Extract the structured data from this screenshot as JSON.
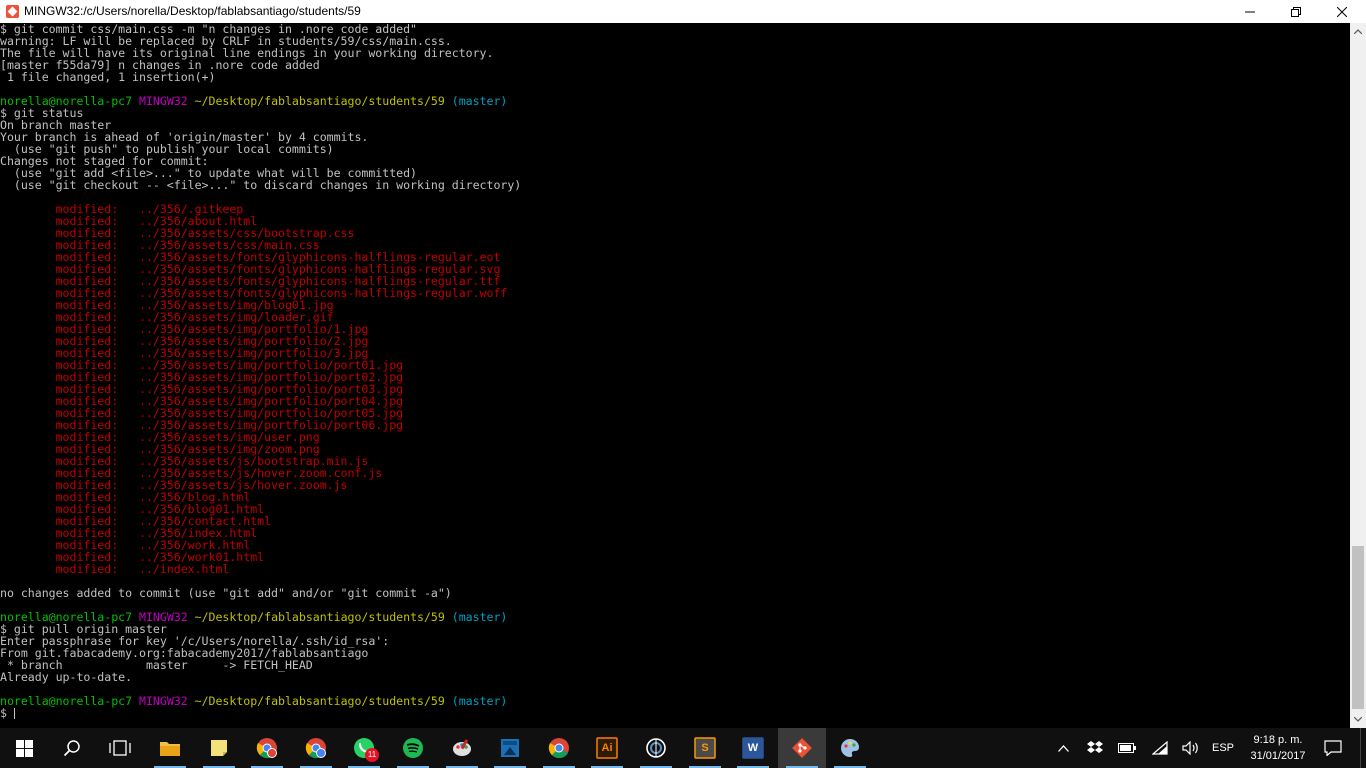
{
  "window": {
    "title": "MINGW32:/c/Users/norella/Desktop/fablabsantiago/students/59"
  },
  "terminal": {
    "lines": [
      [
        {
          "t": "$ git commit css/main.css -m \"n changes in .nore code added\"",
          "c": "default"
        }
      ],
      [
        {
          "t": "warning: LF will be replaced by CRLF in students/59/css/main.css.",
          "c": "default"
        }
      ],
      [
        {
          "t": "The file will have its original line endings in your working directory.",
          "c": "default"
        }
      ],
      [
        {
          "t": "[master f55da79] n changes in .nore code added",
          "c": "default"
        }
      ],
      [
        {
          "t": " 1 file changed, 1 insertion(+)",
          "c": "default"
        }
      ],
      [],
      [
        {
          "t": "norella@norella-pc7",
          "c": "green"
        },
        {
          "t": " ",
          "c": "default"
        },
        {
          "t": "MINGW32",
          "c": "magenta"
        },
        {
          "t": " ",
          "c": "default"
        },
        {
          "t": "~/Desktop/fablabsantiago/students/59",
          "c": "yellow"
        },
        {
          "t": " ",
          "c": "default"
        },
        {
          "t": "(master)",
          "c": "cyan"
        }
      ],
      [
        {
          "t": "$ git status",
          "c": "default"
        }
      ],
      [
        {
          "t": "On branch master",
          "c": "default"
        }
      ],
      [
        {
          "t": "Your branch is ahead of 'origin/master' by 4 commits.",
          "c": "default"
        }
      ],
      [
        {
          "t": "  (use \"git push\" to publish your local commits)",
          "c": "default"
        }
      ],
      [
        {
          "t": "Changes not staged for commit:",
          "c": "default"
        }
      ],
      [
        {
          "t": "  (use \"git add <file>...\" to update what will be committed)",
          "c": "default"
        }
      ],
      [
        {
          "t": "  (use \"git checkout -- <file>...\" to discard changes in working directory)",
          "c": "default"
        }
      ],
      [],
      [
        {
          "t": "        modified:   ../356/.gitkeep",
          "c": "red"
        }
      ],
      [
        {
          "t": "        modified:   ../356/about.html",
          "c": "red"
        }
      ],
      [
        {
          "t": "        modified:   ../356/assets/css/bootstrap.css",
          "c": "red"
        }
      ],
      [
        {
          "t": "        modified:   ../356/assets/css/main.css",
          "c": "red"
        }
      ],
      [
        {
          "t": "        modified:   ../356/assets/fonts/glyphicons-halflings-regular.eot",
          "c": "red"
        }
      ],
      [
        {
          "t": "        modified:   ../356/assets/fonts/glyphicons-halflings-regular.svg",
          "c": "red"
        }
      ],
      [
        {
          "t": "        modified:   ../356/assets/fonts/glyphicons-halflings-regular.ttf",
          "c": "red"
        }
      ],
      [
        {
          "t": "        modified:   ../356/assets/fonts/glyphicons-halflings-regular.woff",
          "c": "red"
        }
      ],
      [
        {
          "t": "        modified:   ../356/assets/img/blog01.jpg",
          "c": "red"
        }
      ],
      [
        {
          "t": "        modified:   ../356/assets/img/loader.gif",
          "c": "red"
        }
      ],
      [
        {
          "t": "        modified:   ../356/assets/img/portfolio/1.jpg",
          "c": "red"
        }
      ],
      [
        {
          "t": "        modified:   ../356/assets/img/portfolio/2.jpg",
          "c": "red"
        }
      ],
      [
        {
          "t": "        modified:   ../356/assets/img/portfolio/3.jpg",
          "c": "red"
        }
      ],
      [
        {
          "t": "        modified:   ../356/assets/img/portfolio/port01.jpg",
          "c": "red"
        }
      ],
      [
        {
          "t": "        modified:   ../356/assets/img/portfolio/port02.jpg",
          "c": "red"
        }
      ],
      [
        {
          "t": "        modified:   ../356/assets/img/portfolio/port03.jpg",
          "c": "red"
        }
      ],
      [
        {
          "t": "        modified:   ../356/assets/img/portfolio/port04.jpg",
          "c": "red"
        }
      ],
      [
        {
          "t": "        modified:   ../356/assets/img/portfolio/port05.jpg",
          "c": "red"
        }
      ],
      [
        {
          "t": "        modified:   ../356/assets/img/portfolio/port06.jpg",
          "c": "red"
        }
      ],
      [
        {
          "t": "        modified:   ../356/assets/img/user.png",
          "c": "red"
        }
      ],
      [
        {
          "t": "        modified:   ../356/assets/img/zoom.png",
          "c": "red"
        }
      ],
      [
        {
          "t": "        modified:   ../356/assets/js/bootstrap.min.js",
          "c": "red"
        }
      ],
      [
        {
          "t": "        modified:   ../356/assets/js/hover.zoom.conf.js",
          "c": "red"
        }
      ],
      [
        {
          "t": "        modified:   ../356/assets/js/hover.zoom.js",
          "c": "red"
        }
      ],
      [
        {
          "t": "        modified:   ../356/blog.html",
          "c": "red"
        }
      ],
      [
        {
          "t": "        modified:   ../356/blog01.html",
          "c": "red"
        }
      ],
      [
        {
          "t": "        modified:   ../356/contact.html",
          "c": "red"
        }
      ],
      [
        {
          "t": "        modified:   ../356/index.html",
          "c": "red"
        }
      ],
      [
        {
          "t": "        modified:   ../356/work.html",
          "c": "red"
        }
      ],
      [
        {
          "t": "        modified:   ../356/work01.html",
          "c": "red"
        }
      ],
      [
        {
          "t": "        modified:   ../index.html",
          "c": "red"
        }
      ],
      [],
      [
        {
          "t": "no changes added to commit (use \"git add\" and/or \"git commit -a\")",
          "c": "default"
        }
      ],
      [],
      [
        {
          "t": "norella@norella-pc7",
          "c": "green"
        },
        {
          "t": " ",
          "c": "default"
        },
        {
          "t": "MINGW32",
          "c": "magenta"
        },
        {
          "t": " ",
          "c": "default"
        },
        {
          "t": "~/Desktop/fablabsantiago/students/59",
          "c": "yellow"
        },
        {
          "t": " ",
          "c": "default"
        },
        {
          "t": "(master)",
          "c": "cyan"
        }
      ],
      [
        {
          "t": "$ git pull origin master",
          "c": "default"
        }
      ],
      [
        {
          "t": "Enter passphrase for key '/c/Users/norella/.ssh/id_rsa':",
          "c": "default"
        }
      ],
      [
        {
          "t": "From git.fabacademy.org:fabacademy2017/fablabsantiago",
          "c": "default"
        }
      ],
      [
        {
          "t": " * branch            master     -> FETCH_HEAD",
          "c": "default"
        }
      ],
      [
        {
          "t": "Already up-to-date.",
          "c": "default"
        }
      ],
      [],
      [
        {
          "t": "norella@norella-pc7",
          "c": "green"
        },
        {
          "t": " ",
          "c": "default"
        },
        {
          "t": "MINGW32",
          "c": "magenta"
        },
        {
          "t": " ",
          "c": "default"
        },
        {
          "t": "~/Desktop/fablabsantiago/students/59",
          "c": "yellow"
        },
        {
          "t": " ",
          "c": "default"
        },
        {
          "t": "(master)",
          "c": "cyan"
        }
      ]
    ],
    "prompt_symbol": "$ "
  },
  "taskbar": {
    "apps": [
      {
        "name": "file-explorer",
        "icon": "folder-icon",
        "color": "#f0c040"
      },
      {
        "name": "sticky-notes",
        "icon": "sticky-note-icon",
        "color": "#f3e27a"
      },
      {
        "name": "chrome-profile-1",
        "icon": "chrome-icon",
        "color": "#db4437"
      },
      {
        "name": "chrome-profile-2",
        "icon": "chrome-icon",
        "color": "#4285f4"
      },
      {
        "name": "whatsapp",
        "icon": "whatsapp-icon",
        "color": "#25d366",
        "badge": "11"
      },
      {
        "name": "spotify",
        "icon": "spotify-icon",
        "color": "#1db954"
      },
      {
        "name": "paint-app",
        "icon": "paint-icon",
        "color": "#e0e0e0"
      },
      {
        "name": "kindle",
        "icon": "kindle-icon",
        "color": "#1b6fb5"
      },
      {
        "name": "chrome",
        "icon": "chrome-icon",
        "color": "#fbbc05"
      },
      {
        "name": "illustrator",
        "icon": "illustrator-icon",
        "color": "#ff7c00",
        "label": "Ai"
      },
      {
        "name": "fusion-app",
        "icon": "gear-globe-icon",
        "color": "#5c8fbf"
      },
      {
        "name": "sublime-text",
        "icon": "sublime-icon",
        "color": "#ff9800",
        "label": "S"
      },
      {
        "name": "word",
        "icon": "word-icon",
        "color": "#2b579a",
        "label": "W"
      },
      {
        "name": "git-bash",
        "icon": "git-icon",
        "color": "#f05033"
      },
      {
        "name": "paint-3d",
        "icon": "palette-icon",
        "color": "#9cc3e6"
      }
    ],
    "tray": {
      "language": "ESP",
      "time": "9:18 p. m.",
      "date": "31/01/2017"
    }
  }
}
